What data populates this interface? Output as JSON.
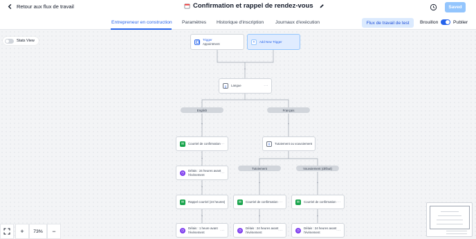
{
  "header": {
    "back_label": "Retour aux flux de travail",
    "title": "Confirmation et rappel de rendez-vous",
    "saved_label": "Saved"
  },
  "tabs": [
    {
      "label": "Entrepreneur en construction",
      "active": true
    },
    {
      "label": "Paramètres",
      "active": false
    },
    {
      "label": "Historique d'inscription",
      "active": false
    },
    {
      "label": "Journaux d'exécution",
      "active": false
    }
  ],
  "actions": {
    "test_label": "Flux de travail de test",
    "draft_label": "Brouillon",
    "publish_label": "Publier",
    "publish_toggle_on": true
  },
  "stats_view": {
    "label": "Stats View",
    "enabled": false
  },
  "flow": {
    "trigger": {
      "title": "Trigger",
      "subtitle": "Appointment"
    },
    "add_trigger": "Add New Trigger",
    "split_language": "Langue",
    "branch_en": "English",
    "branch_fr": "Français",
    "en_mail": "Courriel de confirmation",
    "en_wait_1": "Délais : 24 heures avant l'événement",
    "en_reminder": "Rappel courriel (24 heures)",
    "en_wait_2": "Délais : 1 heure avant l'événement",
    "split_tone": "Tutoiement ou vouvoiement",
    "branch_tu": "Tutoiement",
    "branch_vous": "Vouvoiement (défaut)",
    "tu_mail": "Courriel de confirmation",
    "tu_wait": "Délais : 24 heures avant l'événement",
    "vous_mail": "Courriel de confirmation",
    "vous_wait": "Délais : 24 heures avant l'événement",
    "more": "···"
  },
  "zoom": {
    "level": "73%",
    "plus": "+",
    "minus": "−"
  },
  "colors": {
    "accent": "#2563eb",
    "email_icon": "#16a34a",
    "wait_icon": "#7c3aed"
  },
  "icons": {
    "back": "chevron-left-icon",
    "calendar": "calendar-icon",
    "edit": "pencil-icon",
    "history": "history-icon",
    "fit": "fit-view-icon"
  }
}
